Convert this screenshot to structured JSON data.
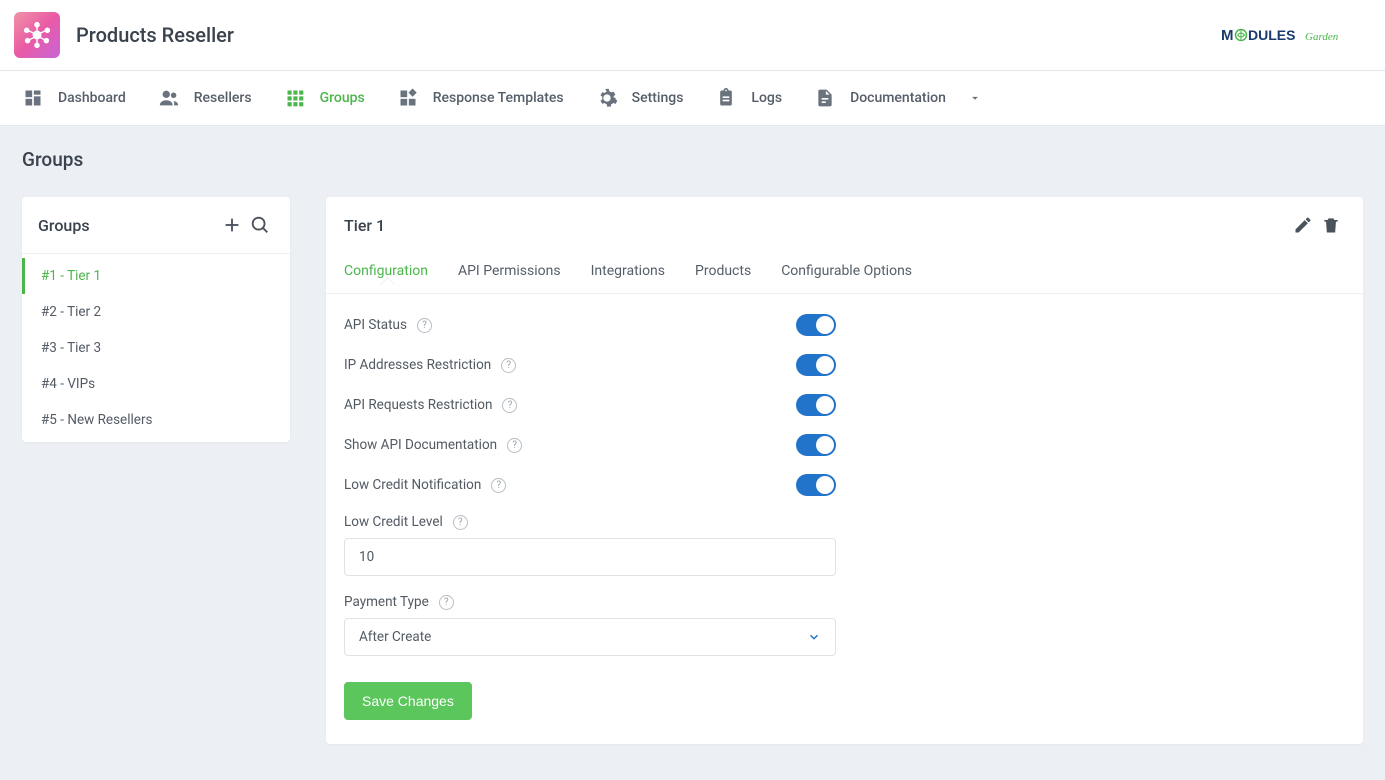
{
  "header": {
    "title": "Products Reseller",
    "brand_m": "M",
    "brand_dules": "DULES",
    "brand_garden": "Garden"
  },
  "nav": [
    {
      "label": "Dashboard",
      "active": false
    },
    {
      "label": "Resellers",
      "active": false
    },
    {
      "label": "Groups",
      "active": true
    },
    {
      "label": "Response Templates",
      "active": false
    },
    {
      "label": "Settings",
      "active": false
    },
    {
      "label": "Logs",
      "active": false
    },
    {
      "label": "Documentation",
      "active": false,
      "dropdown": true
    }
  ],
  "page_title": "Groups",
  "sidebar": {
    "title": "Groups",
    "items": [
      {
        "label": "#1 - Tier 1",
        "active": true
      },
      {
        "label": "#2 - Tier 2",
        "active": false
      },
      {
        "label": "#3 - Tier 3",
        "active": false
      },
      {
        "label": "#4 - VIPs",
        "active": false
      },
      {
        "label": "#5 - New Resellers",
        "active": false
      }
    ]
  },
  "main": {
    "title": "Tier 1",
    "tabs": [
      {
        "label": "Configuration",
        "active": true
      },
      {
        "label": "API Permissions",
        "active": false
      },
      {
        "label": "Integrations",
        "active": false
      },
      {
        "label": "Products",
        "active": false
      },
      {
        "label": "Configurable Options",
        "active": false
      }
    ],
    "toggles": [
      {
        "label": "API Status",
        "on": true
      },
      {
        "label": "IP Addresses Restriction",
        "on": true
      },
      {
        "label": "API Requests Restriction",
        "on": true
      },
      {
        "label": "Show API Documentation",
        "on": true
      },
      {
        "label": "Low Credit Notification",
        "on": true
      }
    ],
    "low_credit_label": "Low Credit Level",
    "low_credit_value": "10",
    "payment_type_label": "Payment Type",
    "payment_type_value": "After Create",
    "save_label": "Save Changes"
  }
}
